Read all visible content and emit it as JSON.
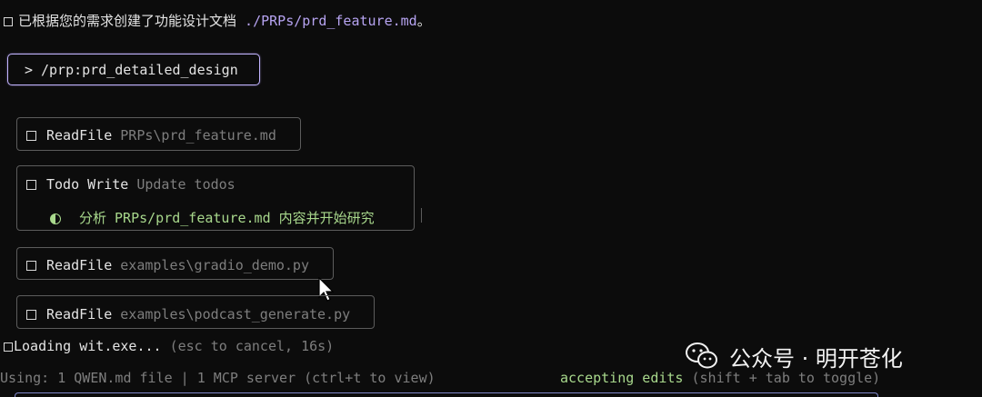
{
  "summary": {
    "text": "已根据您的需求创建了功能设计文档 ",
    "path": "./PRPs/prd_feature.md",
    "end": "。"
  },
  "prompt": {
    "chevron": ">",
    "command": "/prp:prd_detailed_design"
  },
  "tools": [
    {
      "name": "ReadFile",
      "detail": "PRPs\\prd_feature.md"
    },
    {
      "name": "Todo Write",
      "detail": "Update todos",
      "todo": "分析 PRPs/prd_feature.md 内容并开始研究"
    },
    {
      "name": "ReadFile",
      "detail": "examples\\gradio_demo.py"
    },
    {
      "name": "ReadFile",
      "detail": "examples\\podcast_generate.py"
    }
  ],
  "loading": {
    "text": "Loading wit.exe...",
    "hint": " (esc to cancel, 16s)"
  },
  "status": {
    "using": "Using: 1 QWEN.md file | 1 MCP server (ctrl+t to view)",
    "mode": "accepting edits",
    "mode_hint": " (shift + tab to toggle)"
  },
  "watermark": {
    "text": "公众号 · 明开苍化"
  },
  "colors": {
    "accent": "#b7a4f2",
    "todo_green": "#a8d88c"
  }
}
